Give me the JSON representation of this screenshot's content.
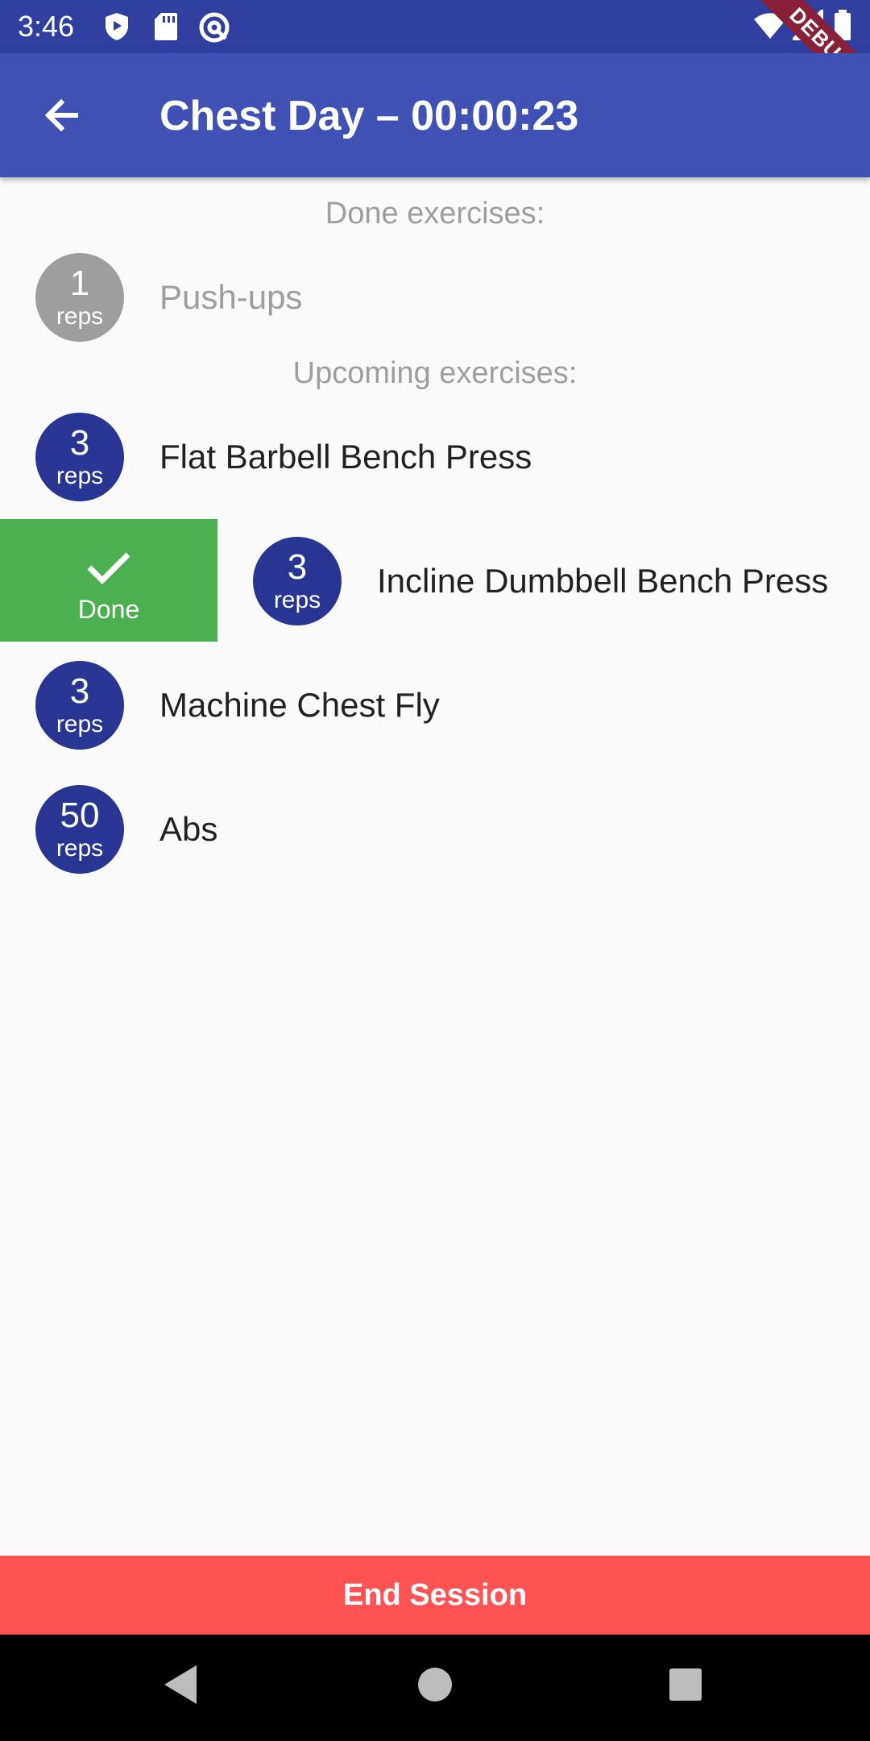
{
  "status_bar": {
    "time": "3:46",
    "left_icons": [
      "shield-icon",
      "sd-card-icon",
      "at-sign-icon"
    ],
    "right_icons": [
      "wifi-icon",
      "signal-icon",
      "battery-icon"
    ],
    "debug_label": "DEBUG"
  },
  "app_bar": {
    "title": "Chest Day – 00:00:23",
    "back_icon": "arrow-back-icon",
    "color": "#3f51b5"
  },
  "done_section": {
    "label": "Done exercises:",
    "items": [
      {
        "reps": "1",
        "unit": "reps",
        "name": "Push-ups"
      }
    ]
  },
  "upcoming_section": {
    "label": "Upcoming exercises:",
    "items": [
      {
        "reps": "3",
        "unit": "reps",
        "name": "Flat Barbell Bench Press"
      },
      {
        "reps": "3",
        "unit": "reps",
        "name": "Incline Dumbbell Bench Press"
      },
      {
        "reps": "3",
        "unit": "reps",
        "name": "Machine Chest Fly"
      },
      {
        "reps": "50",
        "unit": "reps",
        "name": "Abs"
      }
    ]
  },
  "swipe_action": {
    "label": "Done",
    "icon": "check-icon",
    "color": "#4caf50"
  },
  "end_button": {
    "label": "End Session",
    "color": "#ff5252"
  },
  "nav_bar": {
    "icons": [
      "back-triangle-icon",
      "home-circle-icon",
      "recents-square-icon"
    ]
  }
}
